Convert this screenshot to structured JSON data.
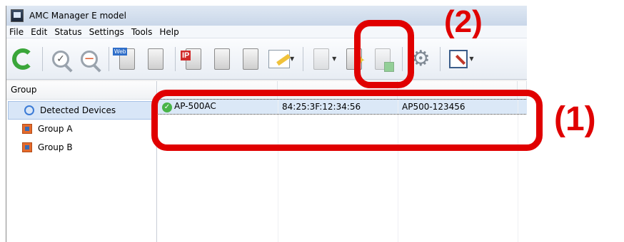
{
  "window": {
    "title": "AMC Manager E model"
  },
  "menu": [
    "File",
    "Edit",
    "Status",
    "Settings",
    "Tools",
    "Help"
  ],
  "toolbar": {
    "buttons": [
      "refresh-icon",
      "search-device-icon",
      "zoom-out-icon",
      "web-device-icon",
      "device-properties-icon",
      "ip-settings-icon",
      "device-settings-icon",
      "group-settings-icon",
      "edit-icon",
      "device-dropdown-icon",
      "new-device-icon",
      "power-device-icon",
      "gear-icon",
      "tools-icon"
    ],
    "ip_badge": "IP",
    "web_badge": "Web"
  },
  "left_pane": {
    "header": "Group",
    "items": [
      {
        "label": "Detected Devices",
        "icon": "search-icon",
        "selected": true
      },
      {
        "label": "Group A",
        "icon": "group-icon",
        "selected": false
      },
      {
        "label": "Group B",
        "icon": "group-icon",
        "selected": false
      }
    ]
  },
  "grid": {
    "rows": [
      {
        "name": "AP-500AC",
        "mac": "84:25:3F:12:34:56",
        "id": "AP500-123456",
        "status": "ok"
      }
    ]
  },
  "annotations": {
    "label1": "(1)",
    "label2": "(2)",
    "color": "#e00000"
  }
}
